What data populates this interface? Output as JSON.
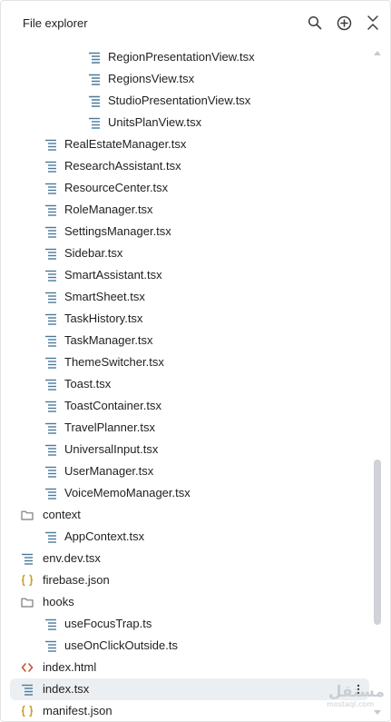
{
  "header": {
    "title": "File explorer"
  },
  "tree": [
    {
      "label": "RegionPresentationView.tsx",
      "type": "file-lines",
      "depth": 3
    },
    {
      "label": "RegionsView.tsx",
      "type": "file-lines",
      "depth": 3
    },
    {
      "label": "StudioPresentationView.tsx",
      "type": "file-lines",
      "depth": 3
    },
    {
      "label": "UnitsPlanView.tsx",
      "type": "file-lines",
      "depth": 3
    },
    {
      "label": "RealEstateManager.tsx",
      "type": "file-lines",
      "depth": 1
    },
    {
      "label": "ResearchAssistant.tsx",
      "type": "file-lines",
      "depth": 1
    },
    {
      "label": "ResourceCenter.tsx",
      "type": "file-lines",
      "depth": 1
    },
    {
      "label": "RoleManager.tsx",
      "type": "file-lines",
      "depth": 1
    },
    {
      "label": "SettingsManager.tsx",
      "type": "file-lines",
      "depth": 1
    },
    {
      "label": "Sidebar.tsx",
      "type": "file-lines",
      "depth": 1
    },
    {
      "label": "SmartAssistant.tsx",
      "type": "file-lines",
      "depth": 1
    },
    {
      "label": "SmartSheet.tsx",
      "type": "file-lines",
      "depth": 1
    },
    {
      "label": "TaskHistory.tsx",
      "type": "file-lines",
      "depth": 1
    },
    {
      "label": "TaskManager.tsx",
      "type": "file-lines",
      "depth": 1
    },
    {
      "label": "ThemeSwitcher.tsx",
      "type": "file-lines",
      "depth": 1
    },
    {
      "label": "Toast.tsx",
      "type": "file-lines",
      "depth": 1
    },
    {
      "label": "ToastContainer.tsx",
      "type": "file-lines",
      "depth": 1
    },
    {
      "label": "TravelPlanner.tsx",
      "type": "file-lines",
      "depth": 1
    },
    {
      "label": "UniversalInput.tsx",
      "type": "file-lines",
      "depth": 1
    },
    {
      "label": "UserManager.tsx",
      "type": "file-lines",
      "depth": 1
    },
    {
      "label": "VoiceMemoManager.tsx",
      "type": "file-lines",
      "depth": 1
    },
    {
      "label": "context",
      "type": "folder",
      "depth": 0
    },
    {
      "label": "AppContext.tsx",
      "type": "file-lines",
      "depth": 1
    },
    {
      "label": "env.dev.tsx",
      "type": "file-lines",
      "depth": 0
    },
    {
      "label": "firebase.json",
      "type": "json",
      "depth": 0
    },
    {
      "label": "hooks",
      "type": "folder",
      "depth": 0
    },
    {
      "label": "useFocusTrap.ts",
      "type": "file-lines",
      "depth": 1
    },
    {
      "label": "useOnClickOutside.ts",
      "type": "file-lines",
      "depth": 1
    },
    {
      "label": "index.html",
      "type": "html",
      "depth": 0
    },
    {
      "label": "index.tsx",
      "type": "file-lines",
      "depth": 0,
      "selected": true
    },
    {
      "label": "manifest.json",
      "type": "json",
      "depth": 0
    }
  ],
  "watermark": {
    "line1": "مستقل",
    "line2": "mostaql.com"
  },
  "colors": {
    "file_icon": "#4a7a9c",
    "json_icon": "#c9a227",
    "html_icon": "#c0562b",
    "folder_icon": "#7a7a7a",
    "selected_bg": "#eceff1",
    "scroll_thumb": "#cfd2d6"
  },
  "icons": {
    "search": "search-icon",
    "add": "add-circle-icon",
    "collapse": "collapse-all-icon",
    "more": "more-vertical-icon"
  }
}
